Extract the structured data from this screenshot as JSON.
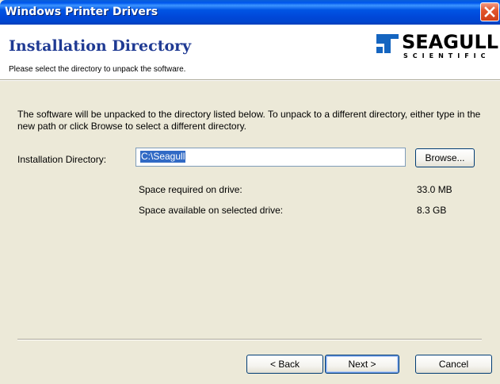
{
  "window": {
    "title": "Windows Printer Drivers"
  },
  "header": {
    "title": "Installation Directory",
    "subtitle": "Please select the directory to unpack the software.",
    "logo": {
      "brand": "SEAGULL",
      "sub": "SCIENTIFIC"
    }
  },
  "body": {
    "description": "The software will be unpacked to the directory listed below.  To unpack to a different directory, either type in the new path or click Browse to select a different directory."
  },
  "directory": {
    "label": "Installation Directory:",
    "value": "C:\\Seagull",
    "browse_label": "Browse..."
  },
  "space": {
    "required_label": "Space required on drive:",
    "required_value": "33.0 MB",
    "available_label": "Space available on selected drive:",
    "available_value": "8.3 GB"
  },
  "footer": {
    "back_label": "< Back",
    "next_label": "Next >",
    "cancel_label": "Cancel"
  },
  "colors": {
    "titlebar": "#0058ee",
    "header_title": "#1f3a93",
    "selection": "#316ac5",
    "close": "#e3572e"
  }
}
